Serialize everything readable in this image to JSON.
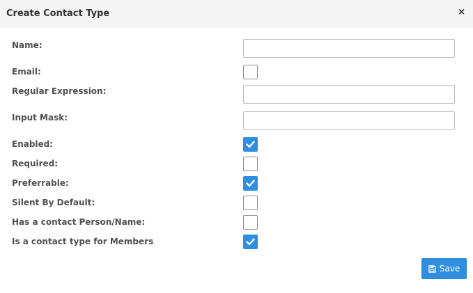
{
  "dialog": {
    "title": "Create Contact Type",
    "close_icon": "close-icon",
    "close_glyph": "×"
  },
  "fields": {
    "name": {
      "label": "Name:",
      "value": ""
    },
    "email": {
      "label": "Email:",
      "checked": false
    },
    "regular_expression": {
      "label": "Regular Expression:",
      "value": ""
    },
    "input_mask": {
      "label": "Input Mask:",
      "value": ""
    },
    "enabled": {
      "label": "Enabled:",
      "checked": true
    },
    "required": {
      "label": "Required:",
      "checked": false
    },
    "preferrable": {
      "label": "Preferrable:",
      "checked": true
    },
    "silent_by_default": {
      "label": "Silent By Default:",
      "checked": false
    },
    "has_contact_person": {
      "label": "Has a contact Person/Name:",
      "checked": false
    },
    "member_contact_type": {
      "label": "Is a contact type for Members",
      "checked": true
    }
  },
  "footer": {
    "save_label": "Save",
    "save_icon": "floppy-disk-icon"
  },
  "colors": {
    "accent": "#2f8ee0",
    "header_bg": "#f4f4f4",
    "label_text": "#505050"
  }
}
